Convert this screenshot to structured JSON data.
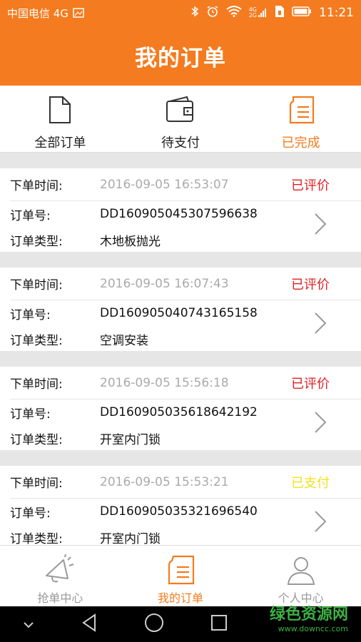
{
  "status_bar": {
    "carrier": "中国电信 4G",
    "time": "11:21",
    "net_small": "4G",
    "net_small2": "2G"
  },
  "header": {
    "title": "我的订单"
  },
  "tabs": [
    {
      "label": "全部订单",
      "icon": "document-icon"
    },
    {
      "label": "待支付",
      "icon": "wallet-icon"
    },
    {
      "label": "已完成",
      "icon": "list-doc-icon",
      "active": true
    }
  ],
  "fields": {
    "time_label": "下单时间:",
    "no_label": "订单号:",
    "type_label": "订单类型:"
  },
  "orders": [
    {
      "time": "2016-09-05 16:53:07",
      "status": "已评价",
      "status_color": "#e02020",
      "no": "DD160905045307596638",
      "type": "木地板抛光"
    },
    {
      "time": "2016-09-05 16:07:43",
      "status": "已评价",
      "status_color": "#e02020",
      "no": "DD160905040743165158",
      "type": "空调安装"
    },
    {
      "time": "2016-09-05 15:56:18",
      "status": "已评价",
      "status_color": "#e02020",
      "no": "DD160905035618642192",
      "type": "开室内门锁"
    },
    {
      "time": "2016-09-05 15:53:21",
      "status": "已支付",
      "status_color": "#f2e21b",
      "no": "DD160905035321696540",
      "type": "开室内门锁"
    }
  ],
  "bottom_nav": [
    {
      "label": "抢单中心",
      "icon": "megaphone-icon"
    },
    {
      "label": "我的订单",
      "icon": "list-doc-icon",
      "active": true
    },
    {
      "label": "个人中心",
      "icon": "person-icon"
    }
  ],
  "watermark": {
    "line1": "绿色资源网",
    "line2": "www.downcc.com"
  },
  "colors": {
    "accent": "#f47b1f",
    "evaluated": "#e02020",
    "paid": "#f2e21b"
  }
}
